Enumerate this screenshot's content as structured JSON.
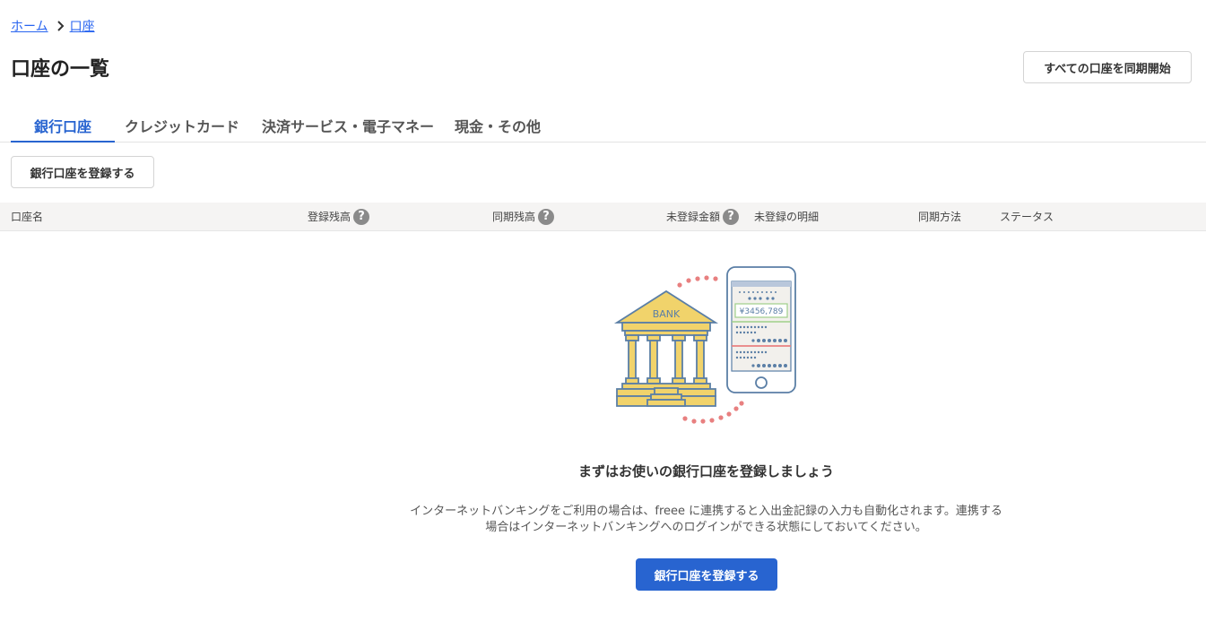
{
  "breadcrumb": {
    "home": "ホーム",
    "current": "口座"
  },
  "page": {
    "title": "口座の一覧"
  },
  "actions": {
    "sync_all": "すべての口座を同期開始",
    "register_bank": "銀行口座を登録する"
  },
  "tabs": [
    {
      "label": "銀行口座",
      "active": true
    },
    {
      "label": "クレジットカード",
      "active": false
    },
    {
      "label": "決済サービス・電子マネー",
      "active": false
    },
    {
      "label": "現金・その他",
      "active": false
    }
  ],
  "table": {
    "columns": [
      {
        "label": "口座名",
        "help": false
      },
      {
        "label": "登録残高",
        "help": true
      },
      {
        "label": "同期残高",
        "help": true
      },
      {
        "label": "未登録金額",
        "help": true
      },
      {
        "label": "未登録の明細",
        "help": false
      },
      {
        "label": "同期方法",
        "help": false
      },
      {
        "label": "ステータス",
        "help": false
      }
    ],
    "help_glyph": "?"
  },
  "illustration": {
    "bank_label": "BANK",
    "phone_amount": "¥3456,789"
  },
  "empty_state": {
    "title": "まずはお使いの銀行口座を登録しましょう",
    "description_line1": "インターネットバンキングをご利用の場合は、freee に連携すると入出金記録の入力も自動化されます。連携する",
    "description_line2": "場合はインターネットバンキングへのログインができる状態にしておいてください。",
    "button": "銀行口座を登録する"
  },
  "colors": {
    "accent": "#2864d0",
    "link": "#2864f0",
    "bank_yellow": "#f1d36b",
    "outline_blue": "#5b7fa6",
    "dots_red": "#e88080"
  }
}
